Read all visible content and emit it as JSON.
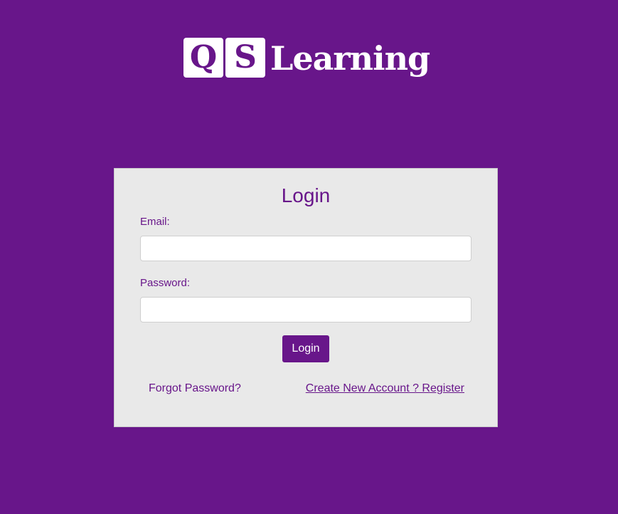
{
  "brand": {
    "tile_1": "Q",
    "tile_2": "S",
    "word": "Learning",
    "accent_color": "#68168a",
    "card_color": "#e9e9e9"
  },
  "login_form": {
    "title": "Login",
    "email_label": "Email:",
    "email_value": "",
    "password_label": "Password:",
    "password_value": "",
    "submit_label": "Login",
    "forgot_link": "Forgot Password?",
    "register_link": "Create New Account ? Register"
  }
}
